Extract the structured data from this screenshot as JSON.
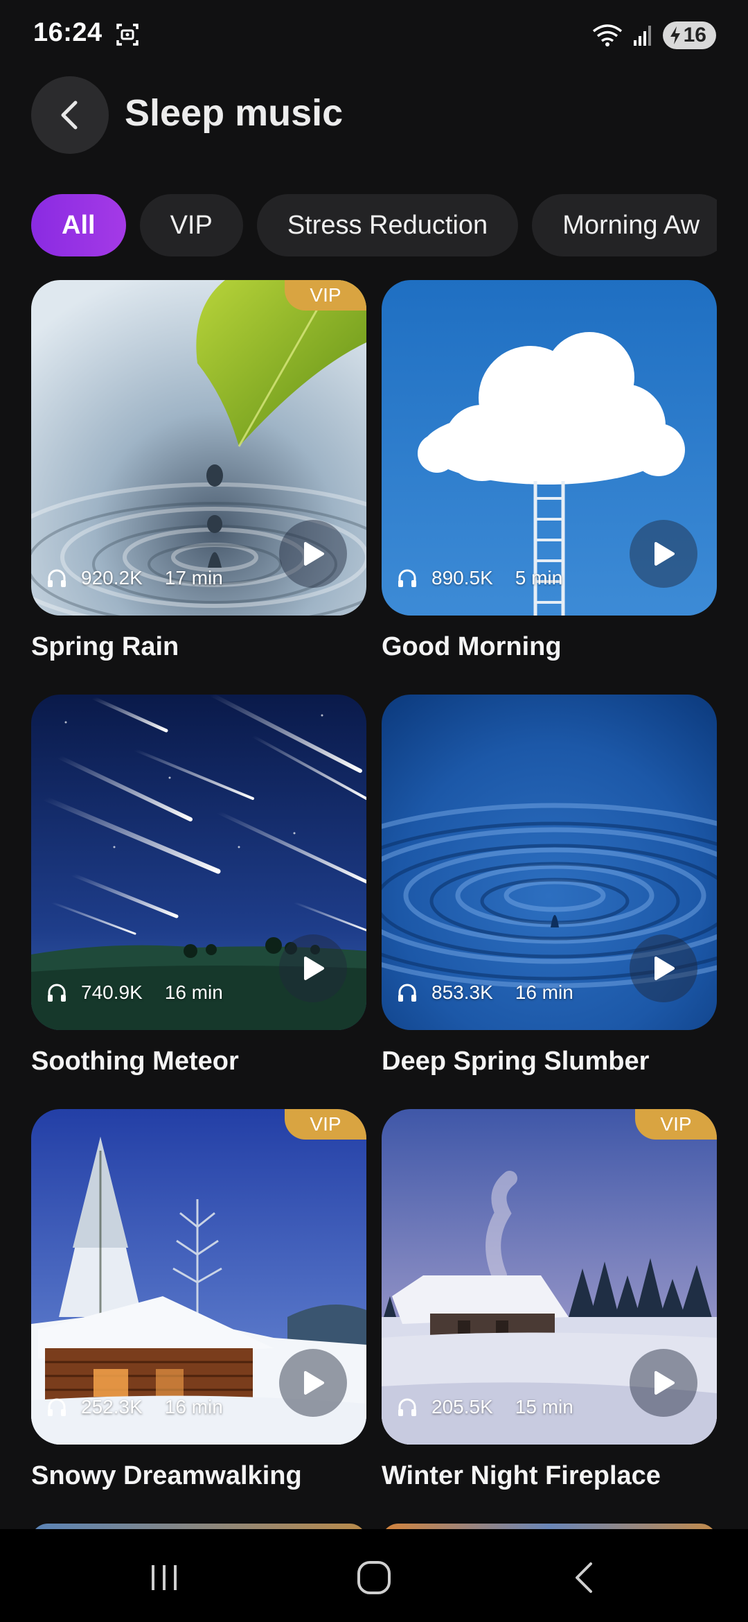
{
  "status_bar": {
    "time": "16:24",
    "battery": "16",
    "icons": [
      "screenshot-icon",
      "wifi-icon",
      "signal-icon",
      "battery-charging-icon"
    ]
  },
  "header": {
    "title": "Sleep music",
    "back_icon": "chevron-left-icon"
  },
  "chips": [
    "All",
    "VIP",
    "Stress Reduction",
    "Morning Aw"
  ],
  "active_chip": "All",
  "tracks": [
    {
      "title": "Spring Rain",
      "plays": "920.2K",
      "duration": "17 min",
      "vip": "VIP"
    },
    {
      "title": "Good Morning",
      "plays": "890.5K",
      "duration": "5 min",
      "vip": ""
    },
    {
      "title": "Soothing Meteor",
      "plays": "740.9K",
      "duration": "16 min",
      "vip": ""
    },
    {
      "title": "Deep Spring Slumber",
      "plays": "853.3K",
      "duration": "16 min",
      "vip": ""
    },
    {
      "title": "Snowy Dreamwalking",
      "plays": "252.3K",
      "duration": "16 min",
      "vip": "VIP"
    },
    {
      "title": "Winter Night Fireplace",
      "plays": "205.5K",
      "duration": "15 min",
      "vip": "VIP"
    }
  ],
  "nav_bar": {
    "icons": [
      "recents-icon",
      "home-icon",
      "back-icon"
    ]
  },
  "colors": {
    "background": "#111112",
    "accent": "#8e2de2",
    "vip": "#d9a441",
    "chip": "#232325"
  }
}
